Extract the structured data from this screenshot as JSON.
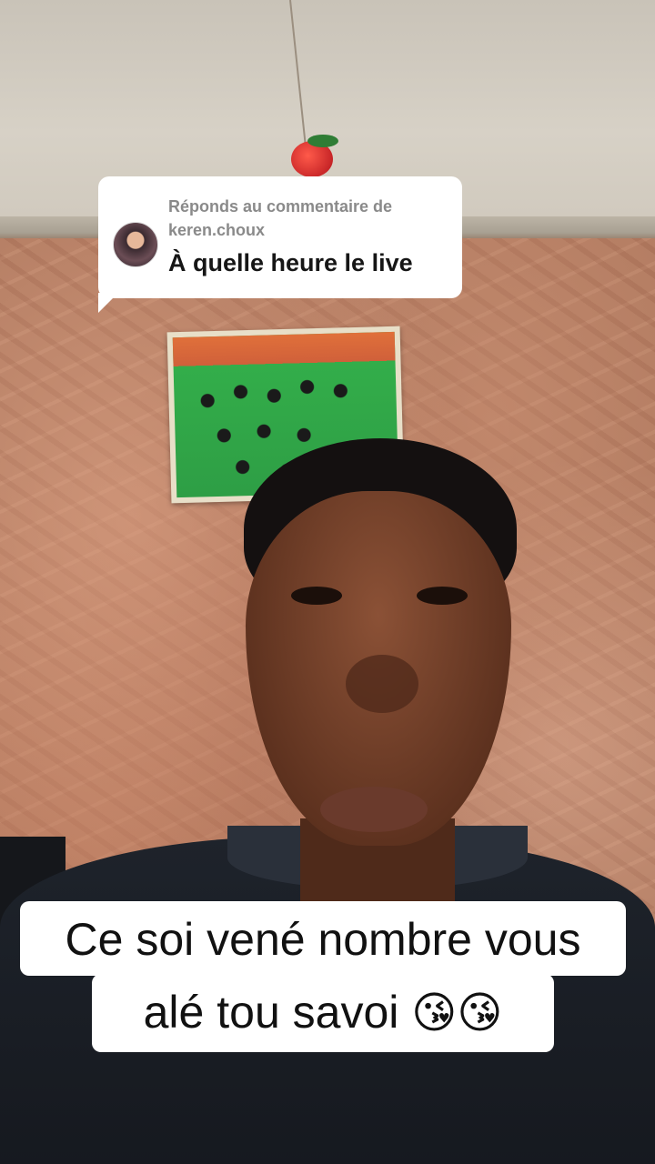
{
  "reply": {
    "header": "Réponds au commentaire de keren.choux",
    "comment": "À quelle heure le live"
  },
  "caption": {
    "line1": "Ce soi vené nombre vous",
    "line2_text": "alé tou savoi",
    "line2_emoji": "😘😘"
  },
  "icons": {
    "avatar": "commenter-avatar"
  },
  "colors": {
    "card": "#ffffff",
    "header_text": "#8a8a8a",
    "comment_text": "#161616"
  }
}
